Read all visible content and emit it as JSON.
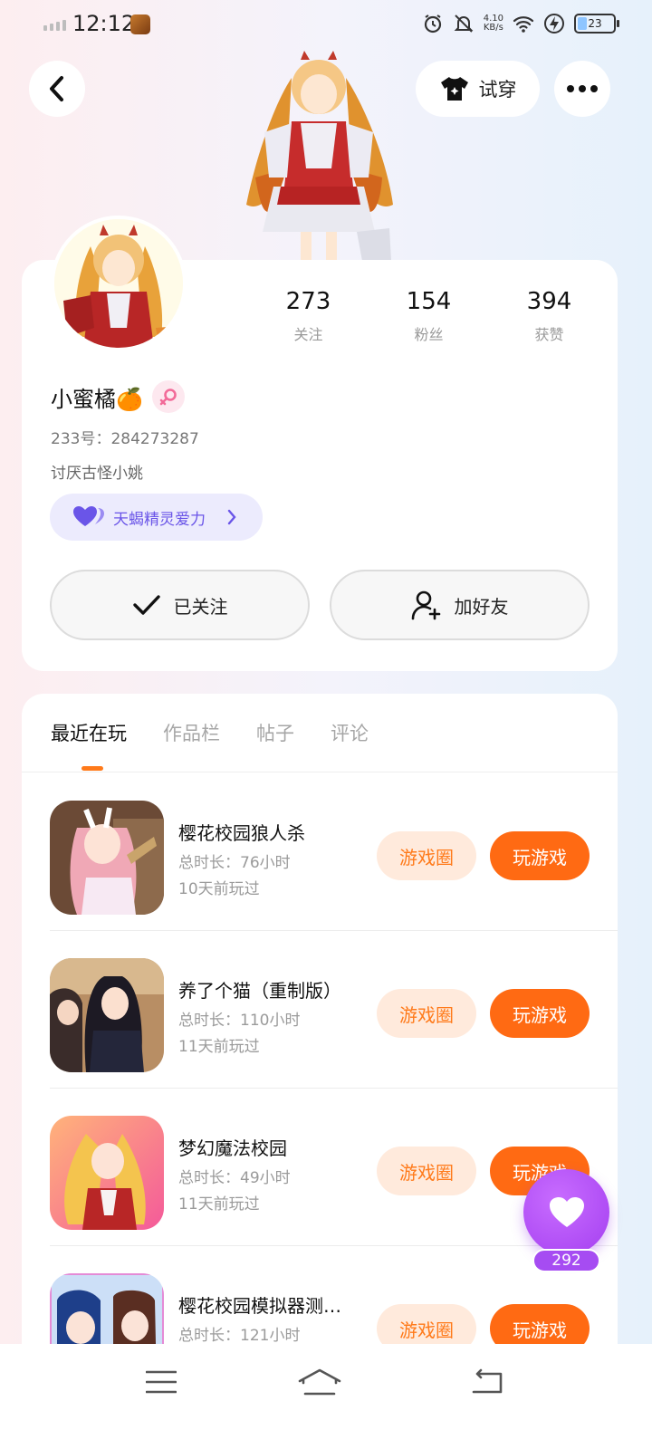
{
  "status_bar": {
    "time": "12:12",
    "net_speed_value": "4.10",
    "net_speed_unit": "KB/s",
    "battery": "23"
  },
  "header": {
    "try_on_label": "试穿"
  },
  "profile": {
    "stats": [
      {
        "value": "273",
        "label": "关注"
      },
      {
        "value": "154",
        "label": "粉丝"
      },
      {
        "value": "394",
        "label": "获赞"
      }
    ],
    "username": "小蜜橘🍊",
    "uid": "233号：284273287",
    "bio": "讨厌古怪小姚",
    "power_label": "天蝎精灵爱力",
    "follow_label": "已关注",
    "add_friend_label": "加好友"
  },
  "tabs": [
    "最近在玩",
    "作品栏",
    "帖子",
    "评论"
  ],
  "games": [
    {
      "title": "樱花校园狼人杀",
      "duration": "总时长：76小时",
      "last_played": "10天前玩过"
    },
    {
      "title": "养了个猫（重制版）",
      "duration": "总时长：110小时",
      "last_played": "11天前玩过"
    },
    {
      "title": "梦幻魔法校园",
      "duration": "总时长：49小时",
      "last_played": "11天前玩过"
    },
    {
      "title": "樱花校园模拟器测…",
      "duration": "总时长：121小时",
      "last_played": ""
    }
  ],
  "game_buttons": {
    "circle_label": "游戏圈",
    "play_label": "玩游戏"
  },
  "like": {
    "count": "292"
  },
  "colors": {
    "accent_orange": "#ff6a13",
    "accent_purple": "#a43ff0",
    "power_purple": "#6a55e8"
  }
}
